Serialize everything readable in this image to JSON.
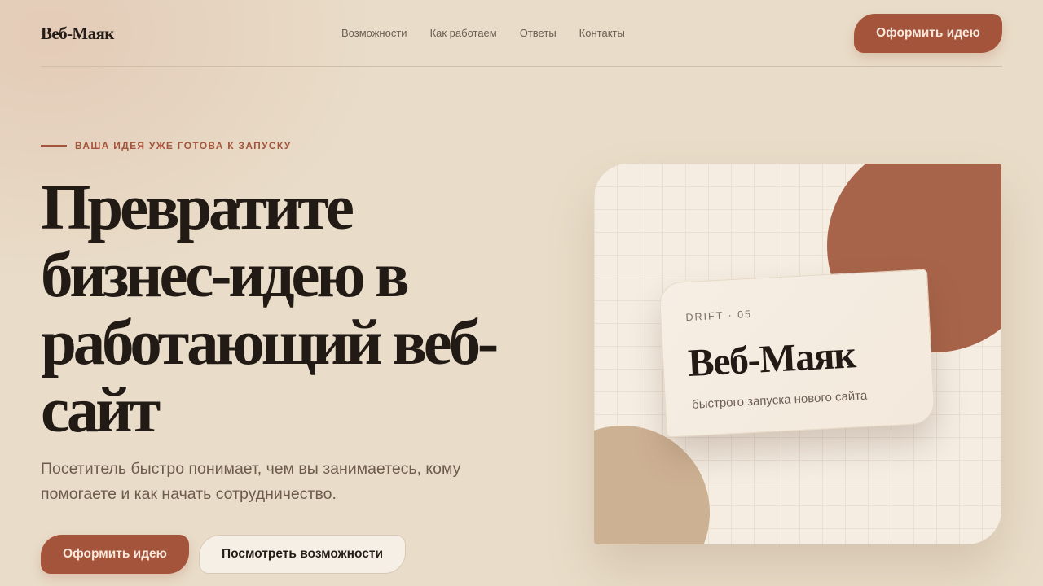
{
  "header": {
    "logo": "Веб-Маяк",
    "nav": [
      "Возможности",
      "Как работаем",
      "Ответы",
      "Контакты"
    ],
    "cta_label": "Оформить идею"
  },
  "hero": {
    "eyebrow": "ВАША ИДЕЯ УЖЕ ГОТОВА К ЗАПУСКУ",
    "headline": "Превратите бизнес-идею в работающий веб-сайт",
    "subtitle": "Посетитель быстро понимает, чем вы занимаетесь, кому помогаете и как начать сотрудничество.",
    "primary_label": "Оформить идею",
    "secondary_label": "Посмотреть возможности"
  },
  "card": {
    "kicker": "DRIFT · 05",
    "title": "Веб-Маяк",
    "subtitle": "быстрого запуска нового сайта"
  },
  "colors": {
    "accent": "#a4543a",
    "background": "#e9ddc9",
    "rust_blob": "#a8644a",
    "sand_blob": "#cdb193",
    "text_dark": "#221a15"
  }
}
